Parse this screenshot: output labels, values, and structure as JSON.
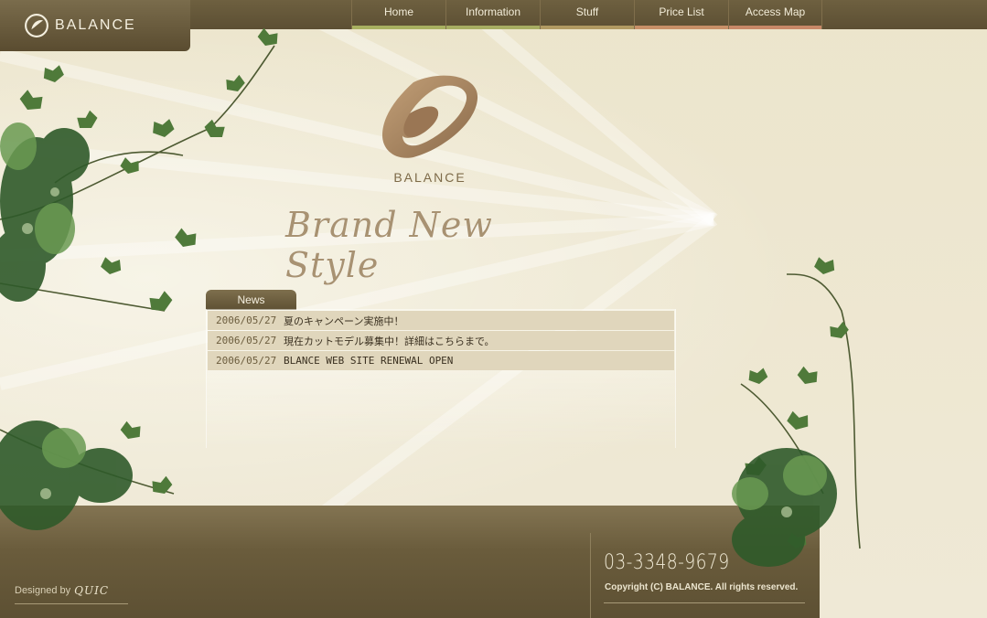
{
  "header": {
    "brand": "BALANCE",
    "nav": [
      {
        "label": "Home",
        "color": "#a8b060"
      },
      {
        "label": "Information",
        "color": "#a7ad62"
      },
      {
        "label": "Stuff",
        "color": "#b19a62"
      },
      {
        "label": "Price List",
        "color": "#c89068"
      },
      {
        "label": "Access Map",
        "color": "#c88868"
      }
    ]
  },
  "hero": {
    "brand": "BALANCE",
    "tagline": "Brand New Style"
  },
  "news": {
    "title": "News",
    "items": [
      {
        "date": "2006/05/27",
        "text": "夏のキャンペーン実施中！"
      },
      {
        "date": "2006/05/27",
        "text": "現在カットモデル募集中！詳細はこちらまで。"
      },
      {
        "date": "2006/05/27",
        "text": "BLANCE WEB SITE RENEWAL OPEN"
      }
    ]
  },
  "footer": {
    "designed_by": "Designed by",
    "designer": "QUIC",
    "phone": "03-3348-9679",
    "copyright": "Copyright (C) BALANCE. All rights reserved."
  },
  "colors": {
    "header_bg": "#5c4f33",
    "page_bg": "#ede7d2",
    "accent_brown": "#8a6a4a"
  }
}
